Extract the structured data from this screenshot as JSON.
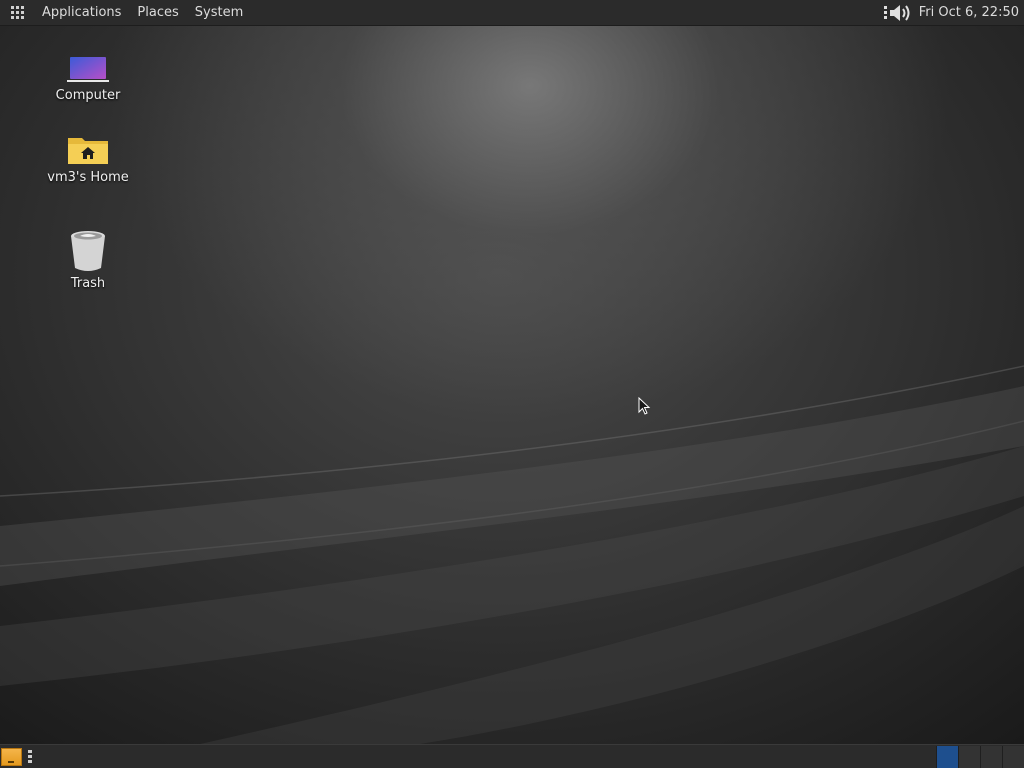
{
  "top_panel": {
    "menus": {
      "applications": "Applications",
      "places": "Places",
      "system": "System"
    },
    "clock": "Fri Oct  6, 22:50"
  },
  "desktop": {
    "icons": [
      {
        "label": "Computer",
        "icon": "computer-icon"
      },
      {
        "label": "vm3's Home",
        "icon": "home-folder-icon"
      },
      {
        "label": "Trash",
        "icon": "trash-icon"
      }
    ]
  },
  "bottom_panel": {
    "workspaces": [
      "1",
      "2",
      "3",
      "4"
    ],
    "active_workspace": 0
  },
  "colors": {
    "panel_bg": "#2b2b2b",
    "active_workspace": "#1e4f8e",
    "folder": "#f2c94c"
  }
}
